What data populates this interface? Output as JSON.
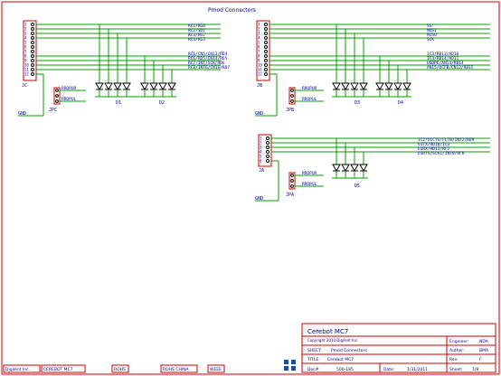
{
  "title": "Pmod Connectors",
  "sections": [
    {
      "connector": "JC",
      "pins": [
        "1",
        "2",
        "3",
        "4",
        "5",
        "6",
        "7",
        "8",
        "9",
        "10",
        "11",
        "12"
      ],
      "upper_nets": [
        "RC1/RG8",
        "RC2/SDI",
        "RC3/RG7",
        "RC4/RG3"
      ],
      "lower_nets": [
        "RC6/CN5/CN13/RD4",
        "RC6/RD5/CN14/RD5",
        "RC7/INT/SCK/RD6",
        "RC8/INT6/CN16/RD7"
      ],
      "jumper": "JPC",
      "jumper_nets": [
        "RROPUR",
        "RROPUL"
      ],
      "diodes": [
        "D1",
        "D2"
      ],
      "gnd": "GND"
    },
    {
      "connector": "JB",
      "pins": [
        "1",
        "2",
        "3",
        "4",
        "5",
        "6",
        "7",
        "8",
        "9",
        "10",
        "11",
        "12"
      ],
      "upper_nets": [
        "SS",
        "MOSI",
        "MISO",
        "SCK"
      ],
      "lower_nets": [
        "IC3/RB13/AD10",
        "IC4/RB14/AD11",
        "USDPE/AN14/RB14",
        "AN15/OCFB/CN12/RB15"
      ],
      "jumper": "JPB",
      "jumper_nets": [
        "RROPUR",
        "RROPUL"
      ],
      "diodes": [
        "D3",
        "D4"
      ],
      "gnd": "GND"
    },
    {
      "connector": "JA",
      "pins": [
        "1",
        "2",
        "3",
        "4",
        "5",
        "6"
      ],
      "upper_nets": [
        "IC2/U1CTS/FLTB/INT2/RD9",
        "U1TX/RD10/IC3",
        "U1RX/RD11/RF2",
        "U1RTS/SCK1/INT0/RF6"
      ],
      "lower_nets": [],
      "jumper": "JPA",
      "jumper_nets": [
        "RROPUR",
        "RROPUL"
      ],
      "diodes": [
        "D5"
      ],
      "gnd": "GND"
    }
  ],
  "title_block": {
    "project": "Cerebot MC7",
    "copyright": "Copyright 2010 Digilent Inc.",
    "engineer_label": "Engineer:",
    "engineer": "NDA",
    "sheet_label": "SHEET:",
    "sheet_name": "Pmod Connectors",
    "author_label": "Author:",
    "author": "BMA",
    "title_label": "TITLE:",
    "title_value": "Cerebot MC7",
    "rev_label": "Rev:",
    "rev": "F",
    "doc_label": "Doc#:",
    "doc": "500-185",
    "date_label": "Date:",
    "date": "1/31/2011",
    "sheets_label": "Sheet:",
    "sheets": "1/8"
  },
  "footer_tags": [
    "Digilent Inc.",
    "CEREBOT MC7",
    "ROHS",
    "ROHS CHINA",
    "WEEE"
  ]
}
